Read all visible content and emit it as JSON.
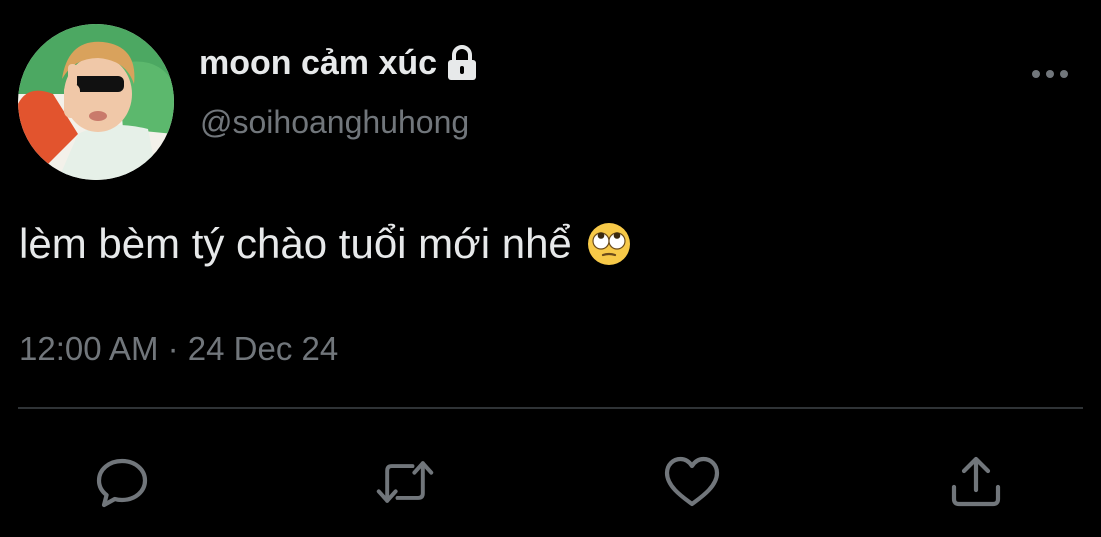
{
  "tweet": {
    "author": {
      "display_name": "moon cảm xúc",
      "handle": "@soihoanghuhong",
      "protected": true
    },
    "text": "lèm bèm tý chào tuổi mới nhể",
    "emoji": "face-with-rolling-eyes",
    "timestamp": "12:00 AM · 24 Dec 24"
  },
  "actions": {
    "reply": "reply-icon",
    "retweet": "retweet-icon",
    "like": "heart-icon",
    "share": "share-icon"
  },
  "colors": {
    "background": "#000000",
    "text_primary": "#e7e9ea",
    "text_secondary": "#71767b",
    "divider": "#2f3336"
  }
}
